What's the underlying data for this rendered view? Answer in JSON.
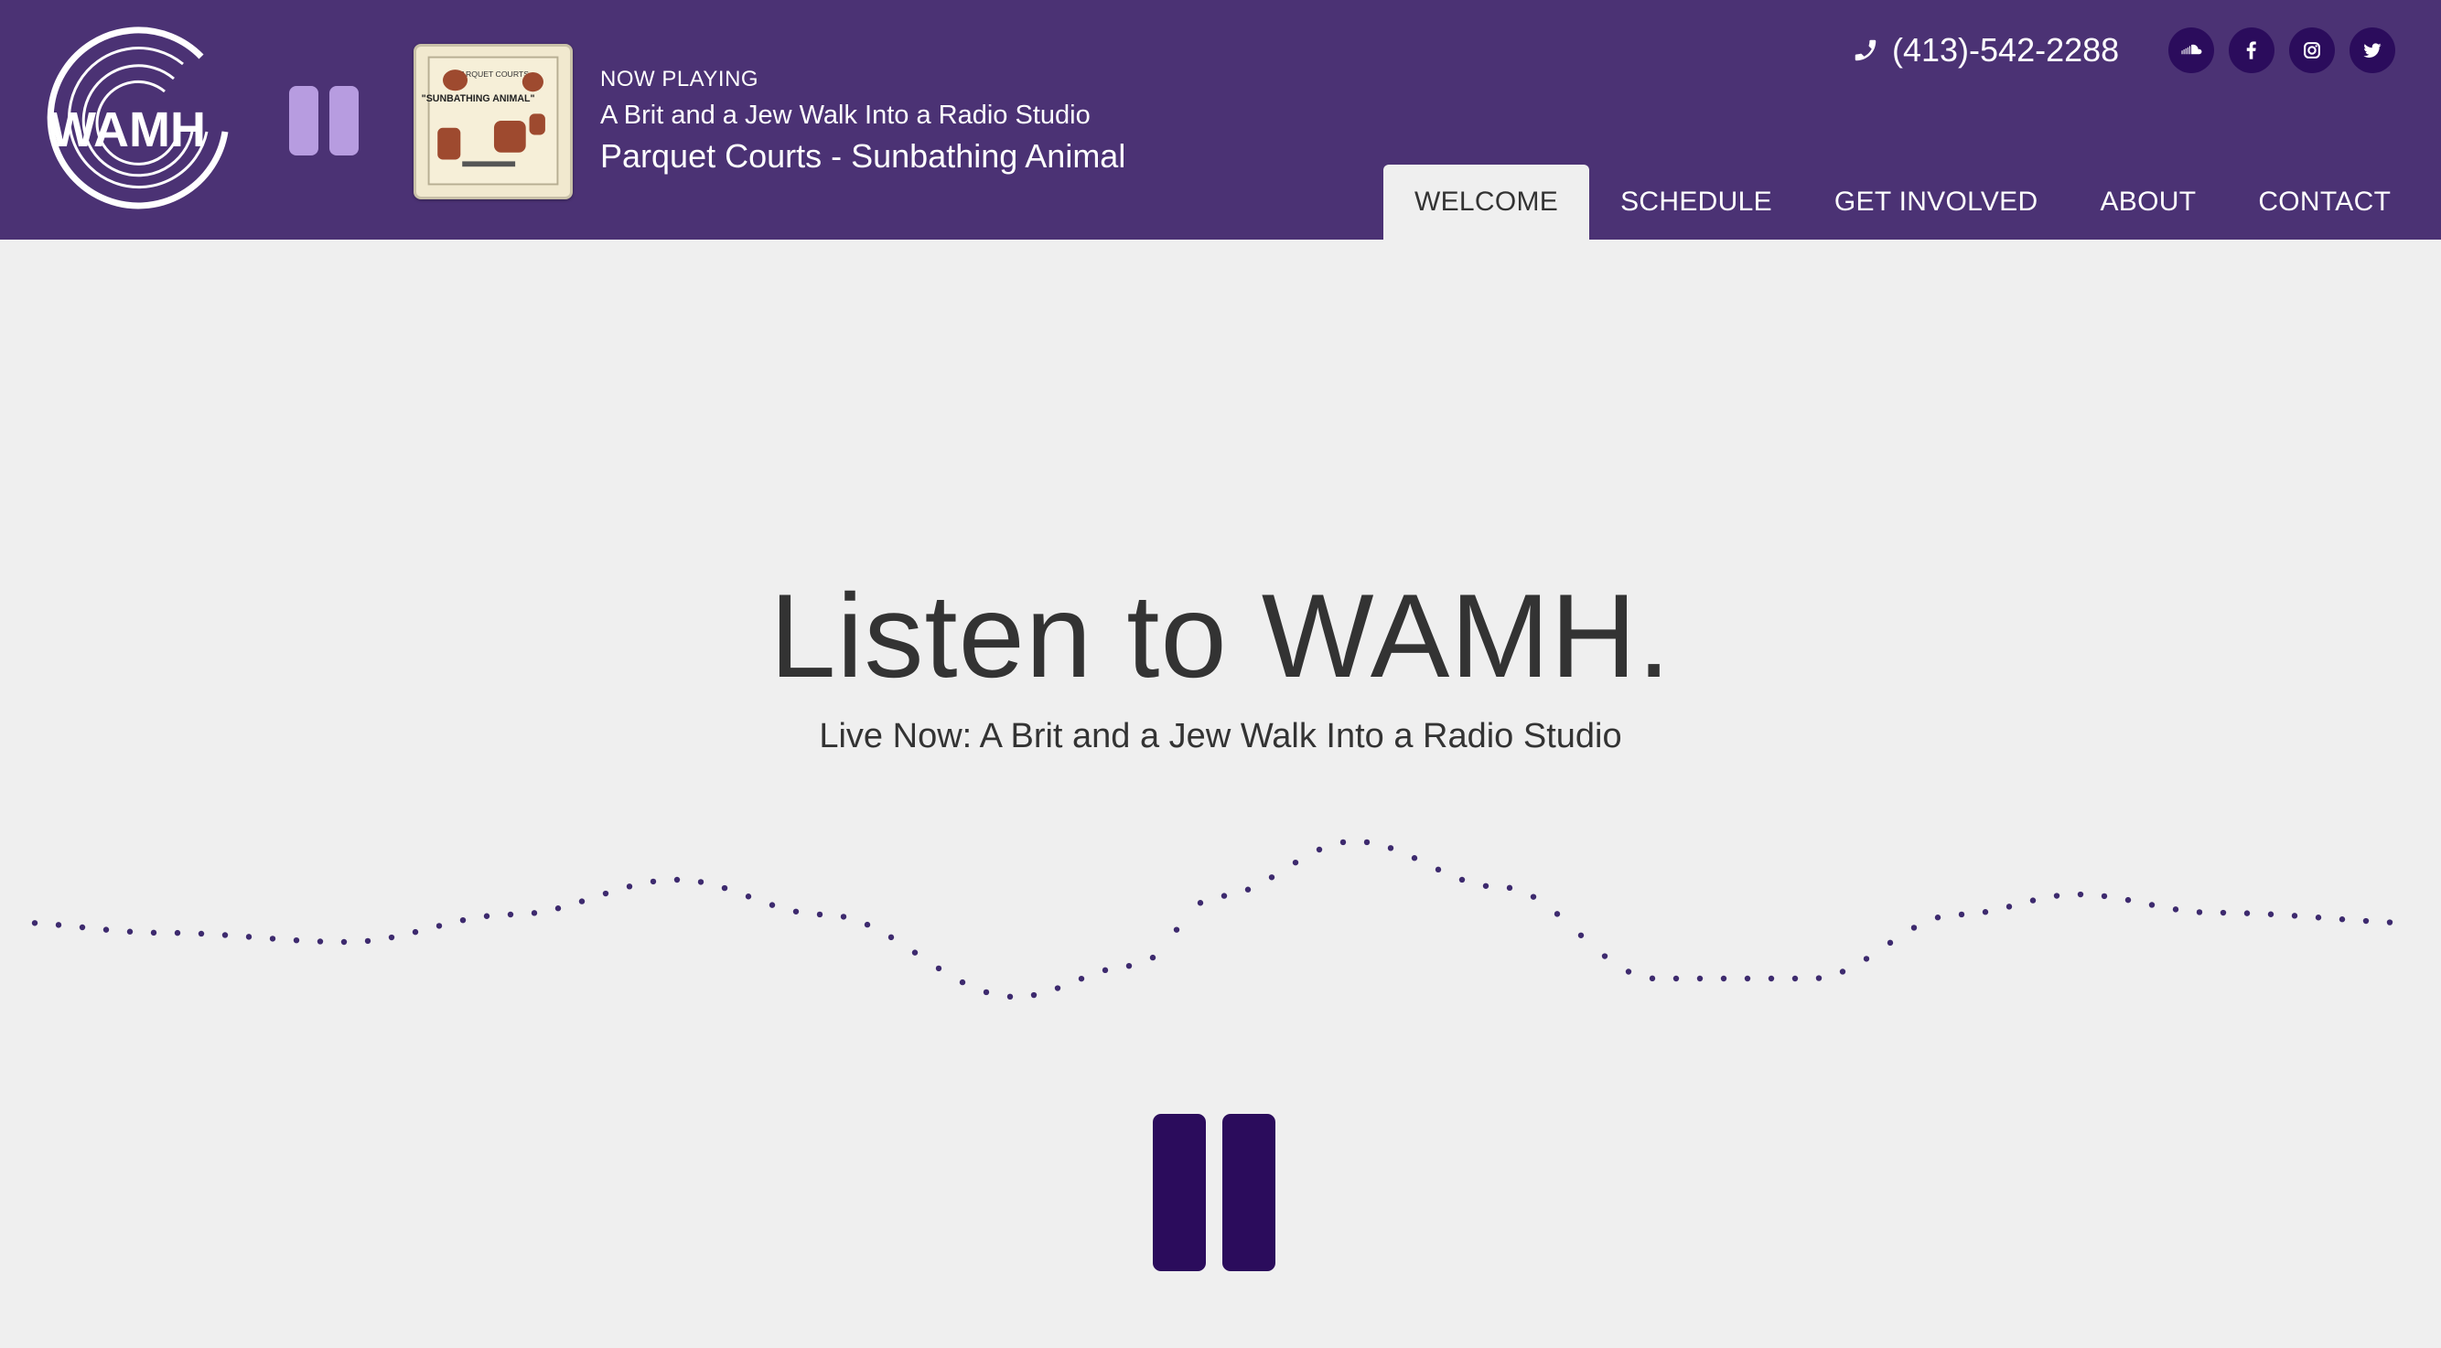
{
  "header": {
    "logo_text": "WAMH",
    "now_playing": {
      "label": "NOW PLAYING",
      "show": "A Brit and a Jew Walk Into a Radio Studio",
      "track": "Parquet Courts - Sunbathing Animal"
    },
    "album_art": {
      "band": "PARQUET COURTS",
      "title": "\"SUNBATHING ANIMAL\""
    },
    "phone": "(413)-542-2288",
    "socials": [
      "soundcloud-icon",
      "facebook-icon",
      "instagram-icon",
      "twitter-icon"
    ]
  },
  "nav": {
    "items": [
      {
        "label": "WELCOME",
        "active": true
      },
      {
        "label": "SCHEDULE",
        "active": false
      },
      {
        "label": "GET INVOLVED",
        "active": false
      },
      {
        "label": "ABOUT",
        "active": false
      },
      {
        "label": "CONTACT",
        "active": false
      }
    ]
  },
  "hero": {
    "title": "Listen to WAMH.",
    "subtitle": "Live Now: A Brit and a Jew Walk Into a Radio Studio"
  },
  "colors": {
    "header_bg": "#4b3274",
    "accent_dark": "#2b0c5c",
    "accent_light": "#b79ce0",
    "page_bg": "#efefef"
  }
}
